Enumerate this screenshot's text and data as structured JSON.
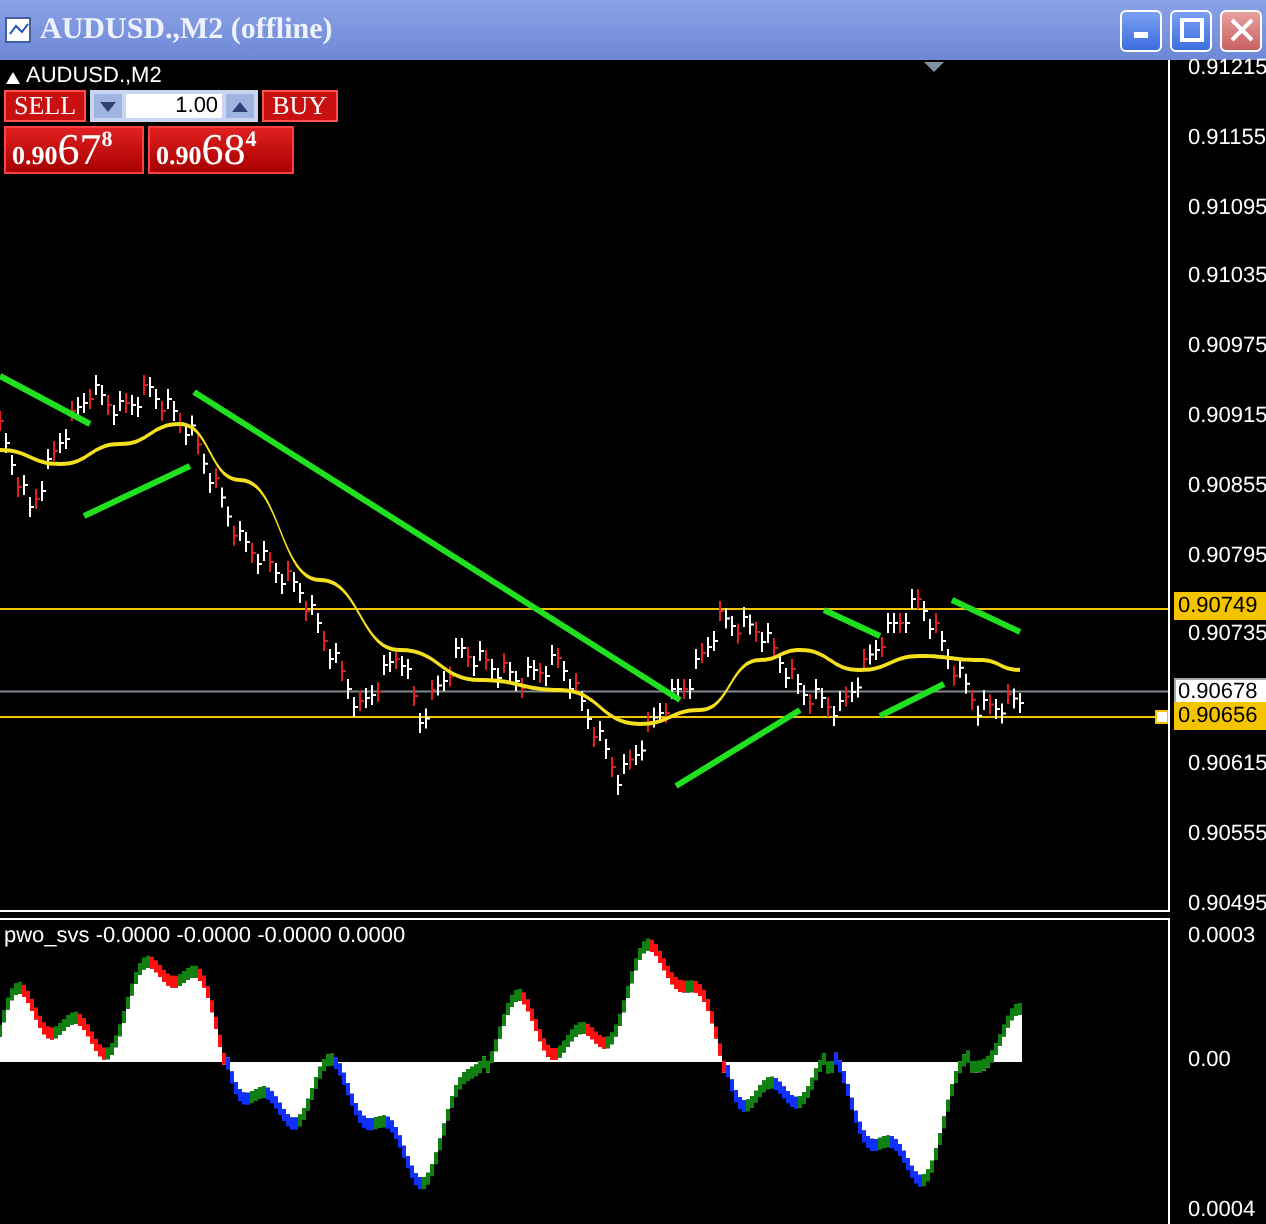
{
  "window": {
    "title": "AUDUSD.,M2 (offline)"
  },
  "chart": {
    "symbol_label": "AUDUSD.,M2",
    "price_axis": [
      "0.91215",
      "0.91155",
      "0.91095",
      "0.91035",
      "0.90975",
      "0.90915",
      "0.90855",
      "0.90795",
      "0.90735",
      "0.90615",
      "0.90555",
      "0.90495"
    ],
    "price_lines": [
      {
        "label": "0.90749",
        "kind": "level"
      },
      {
        "label": "0.90678",
        "kind": "bid"
      },
      {
        "label": "0.90656",
        "kind": "level"
      }
    ]
  },
  "trade_panel": {
    "sell_label": "SELL",
    "buy_label": "BUY",
    "lot": "1.00",
    "sell_price": {
      "head": "0.90",
      "pips": "67",
      "tail": "8"
    },
    "buy_price": {
      "head": "0.90",
      "pips": "68",
      "tail": "4"
    }
  },
  "indicator": {
    "label": "pwo_svs -0.0000 -0.0000 -0.0000 0.0000",
    "axis": [
      "0.0003",
      "0.00",
      "0.0004"
    ]
  }
}
